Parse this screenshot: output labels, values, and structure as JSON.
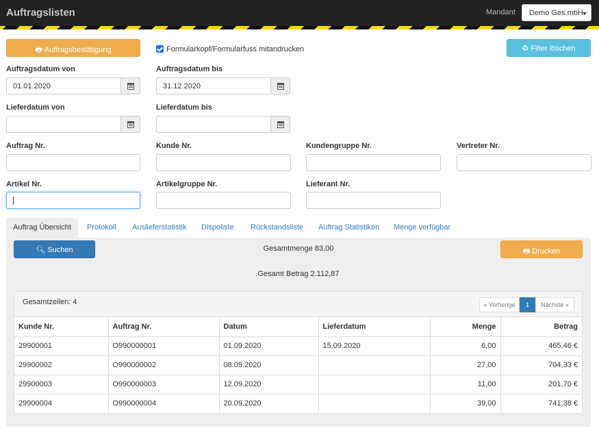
{
  "header": {
    "title": "Auftragslisten",
    "mandant_label": "Mandant",
    "mandant_value": "Demo Ges.mbH"
  },
  "toolbar": {
    "confirm_label": "Auftragsbestätigung",
    "checkbox_label": "Formularkopf/Formularfuss mitandrucken",
    "checkbox_checked": true,
    "clear_filter_label": "Filter löschen"
  },
  "filters": {
    "auftragsdatum_von": {
      "label": "Auftragsdatum von",
      "value": "01.01.2020"
    },
    "auftragsdatum_bis": {
      "label": "Auftragsdatum bis",
      "value": "31.12.2020"
    },
    "lieferdatum_von": {
      "label": "Lieferdatum von",
      "value": ""
    },
    "lieferdatum_bis": {
      "label": "Lieferdatum bis",
      "value": ""
    },
    "auftrag_nr": {
      "label": "Auftrag Nr.",
      "value": ""
    },
    "kunde_nr": {
      "label": "Kunde Nr.",
      "value": ""
    },
    "kundengruppe_nr": {
      "label": "Kundengruppe Nr.",
      "value": ""
    },
    "vertreter_nr": {
      "label": "Vertreter Nr.",
      "value": ""
    },
    "artikel_nr": {
      "label": "Artikel Nr.",
      "value": ""
    },
    "artikelgruppe_nr": {
      "label": "Artikelgruppe Nr.",
      "value": ""
    },
    "lieferant_nr": {
      "label": "Lieferant Nr.",
      "value": ""
    }
  },
  "tabs": [
    {
      "label": "Auftrag Übersicht",
      "active": true
    },
    {
      "label": "Protokoll"
    },
    {
      "label": "Auslieferstatistik"
    },
    {
      "label": "Dispoliste"
    },
    {
      "label": "Rückstandsliste"
    },
    {
      "label": "Auftrag Statistiken"
    },
    {
      "label": "Menge verfügbar"
    }
  ],
  "results": {
    "search_label": "Suchen",
    "print_label": "Drucken",
    "total_quantity": "Gesamtmenge 83,00",
    "total_amount": "Gesamt Betrag 2.112,87",
    "row_count": "Gesamtzeilen: 4",
    "pager": {
      "prev": "« Vorherige",
      "current": "1",
      "next": "Nächste »"
    },
    "columns": [
      "Kunde Nr.",
      "Auftrag Nr.",
      "Datum",
      "Lieferdatum",
      "Menge",
      "Betrag"
    ],
    "rows": [
      [
        "29900001",
        "O990000001",
        "01.09.2020",
        "15.09.2020",
        "6,00",
        "465,46 €"
      ],
      [
        "29900002",
        "O990000002",
        "08.09.2020",
        "",
        "27,00",
        "704,33 €"
      ],
      [
        "29900003",
        "O990000003",
        "12.09.2020",
        "",
        "11,00",
        "201,70 €"
      ],
      [
        "29900004",
        "O990000004",
        "20.09.2020",
        "",
        "39,00",
        "741,38 €"
      ]
    ]
  },
  "colors": {
    "accent_blue": "#337ab7",
    "orange": "#f0ad4e",
    "info": "#5bc0de",
    "topbar": "#222222",
    "stripe_yellow": "#f5d90a"
  }
}
